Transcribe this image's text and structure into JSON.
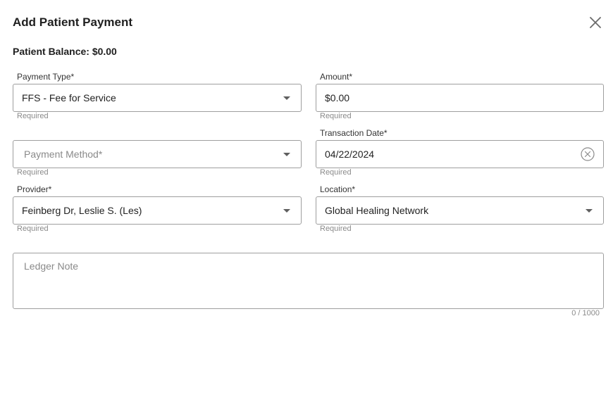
{
  "dialog": {
    "title": "Add Patient Payment",
    "balance_label": "Patient Balance: $0.00"
  },
  "fields": {
    "payment_type": {
      "label": "Payment Type*",
      "value": "FFS - Fee for Service",
      "helper": "Required"
    },
    "amount": {
      "label": "Amount*",
      "value": "$0.00",
      "helper": "Required"
    },
    "payment_method": {
      "placeholder": "Payment Method*",
      "helper": "Required"
    },
    "transaction_date": {
      "label": "Transaction Date*",
      "value": "04/22/2024",
      "helper": "Required"
    },
    "provider": {
      "label": "Provider*",
      "value": "Feinberg Dr, Leslie S. (Les)",
      "helper": "Required"
    },
    "location": {
      "label": "Location*",
      "value": "Global Healing Network",
      "helper": "Required"
    },
    "ledger_note": {
      "placeholder": "Ledger Note",
      "counter": "0 / 1000"
    }
  },
  "colors": {
    "border": "#9e9e9e",
    "helper_text": "#8a8a8a",
    "title_text": "#1f1f1f"
  },
  "icons": {
    "close": "close-icon",
    "dropdown": "chevron-down-icon",
    "clear": "clear-circle-icon"
  }
}
